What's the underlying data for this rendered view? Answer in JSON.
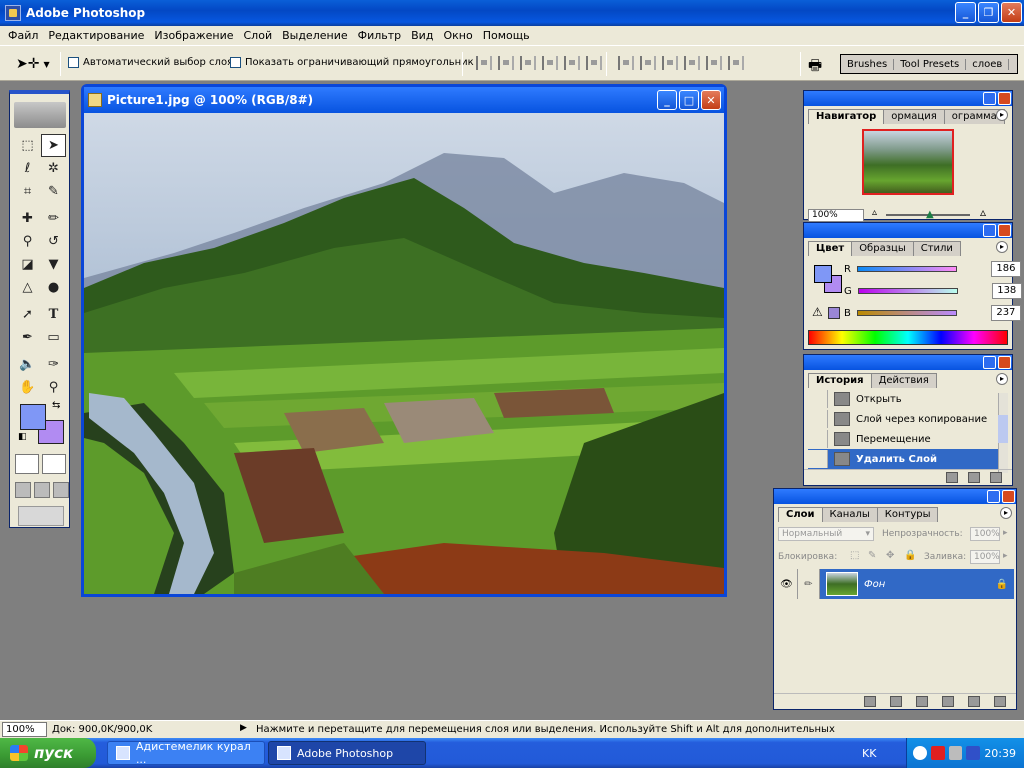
{
  "app": {
    "title": "Adobe Photoshop"
  },
  "menu": [
    "Файл",
    "Редактирование",
    "Изображение",
    "Слой",
    "Выделение",
    "Фильтр",
    "Вид",
    "Окно",
    "Помощь"
  ],
  "options": {
    "auto_select": "Автоматический выбор слоя",
    "show_bounds": "Показать ограничивающий прямоугольник",
    "palette_tabs": [
      "Brushes",
      "Tool Presets",
      "слоев"
    ]
  },
  "document": {
    "title": "Picture1.jpg @ 100% (RGB/8#)"
  },
  "navigator": {
    "tabs": [
      "Навигатор",
      "ормация",
      "ограмма"
    ],
    "zoom": "100%"
  },
  "color": {
    "tabs": [
      "Цвет",
      "Образцы",
      "Стили"
    ],
    "fg": "#7f97f6",
    "bg": "#b18bf2",
    "channels": [
      {
        "label": "R",
        "value": "186"
      },
      {
        "label": "G",
        "value": "138"
      },
      {
        "label": "B",
        "value": "237"
      }
    ]
  },
  "history": {
    "tabs": [
      "История",
      "Действия"
    ],
    "items": [
      "Открыть",
      "Слой через копирование",
      "Перемещение",
      "Удалить Слой"
    ]
  },
  "layers": {
    "tabs": [
      "Слои",
      "Каналы",
      "Контуры"
    ],
    "blend_mode": "Нормальный",
    "opacity_label": "Непрозрачность:",
    "opacity_value": "100%",
    "lock_label": "Блокировка:",
    "fill_label": "Заливка:",
    "fill_value": "100%",
    "layer_name": "Фон"
  },
  "status": {
    "zoom": "100%",
    "doc": "Док: 900,0K/900,0K",
    "hint": "Нажмите и перетащите для перемещения слоя или выделения. Используйте Shift и Alt для дополнительных"
  },
  "taskbar": {
    "start": "пуск",
    "tasks": [
      "Адистемелик курал ...",
      "Adobe Photoshop"
    ],
    "lang": "KK",
    "clock": "20:39"
  }
}
